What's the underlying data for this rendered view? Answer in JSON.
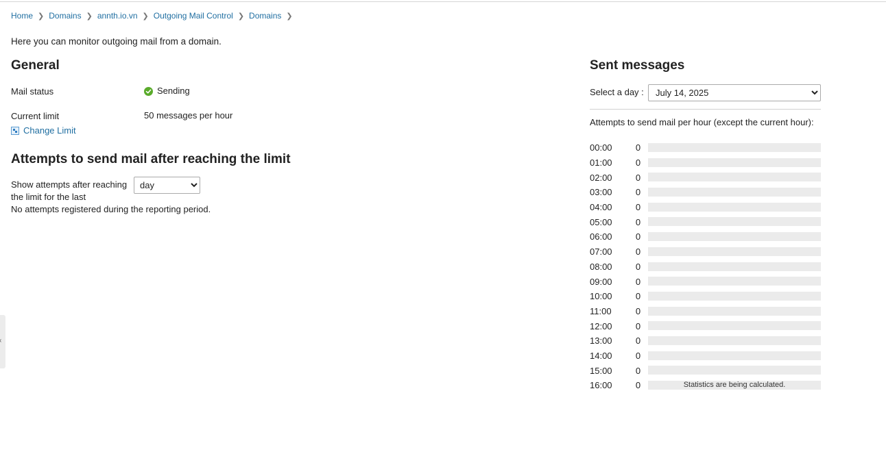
{
  "breadcrumb": [
    {
      "label": "Home"
    },
    {
      "label": "Domains"
    },
    {
      "label": "annth.io.vn"
    },
    {
      "label": "Outgoing Mail Control"
    },
    {
      "label": "Domains"
    }
  ],
  "intro": "Here you can monitor outgoing mail from a domain.",
  "general": {
    "title": "General",
    "mail_status_label": "Mail status",
    "mail_status_value": "Sending",
    "current_limit_label": "Current limit",
    "current_limit_value": "50 messages per hour",
    "change_limit_link": "Change Limit"
  },
  "attempts": {
    "title": "Attempts to send mail after reaching the limit",
    "show_label": "Show attempts after reaching the limit for the last",
    "period_options": [
      "day"
    ],
    "period_selected": "day",
    "empty_text": "No attempts registered during the reporting period."
  },
  "sent": {
    "title": "Sent messages",
    "select_day_label": "Select a day :",
    "day_options": [
      "July 14, 2025"
    ],
    "day_selected": "July 14, 2025",
    "per_hour_label": "Attempts to send mail per hour (except the current hour):",
    "calculating_note": "Statistics are being calculated.",
    "hours": [
      {
        "time": "00:00",
        "count": 0
      },
      {
        "time": "01:00",
        "count": 0
      },
      {
        "time": "02:00",
        "count": 0
      },
      {
        "time": "03:00",
        "count": 0
      },
      {
        "time": "04:00",
        "count": 0
      },
      {
        "time": "05:00",
        "count": 0
      },
      {
        "time": "06:00",
        "count": 0
      },
      {
        "time": "07:00",
        "count": 0
      },
      {
        "time": "08:00",
        "count": 0
      },
      {
        "time": "09:00",
        "count": 0
      },
      {
        "time": "10:00",
        "count": 0
      },
      {
        "time": "11:00",
        "count": 0
      },
      {
        "time": "12:00",
        "count": 0
      },
      {
        "time": "13:00",
        "count": 0
      },
      {
        "time": "14:00",
        "count": 0
      },
      {
        "time": "15:00",
        "count": 0
      },
      {
        "time": "16:00",
        "count": 0,
        "calculating": true
      }
    ]
  },
  "colors": {
    "link": "#1f6ea1",
    "status_ok": "#5aab2b",
    "bar_track": "#ebebeb"
  },
  "icons": {
    "status": "check-circle-icon",
    "change_limit": "change-limit-icon",
    "breadcrumb_separator": "chevron-right-icon"
  }
}
